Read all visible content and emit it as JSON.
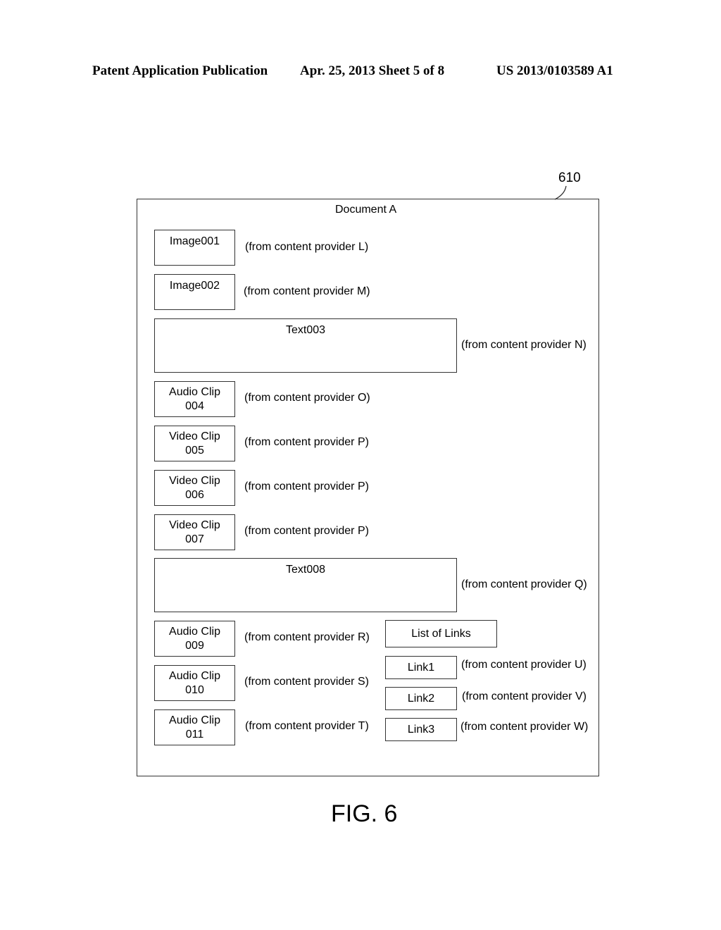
{
  "header": {
    "left": "Patent Application Publication",
    "middle": "Apr. 25, 2013  Sheet 5 of 8",
    "right": "US 2013/0103589 A1"
  },
  "reference_numeral": "610",
  "document": {
    "title": "Document A",
    "items": [
      {
        "label": "Image001",
        "source": "(from content provider L)"
      },
      {
        "label": "Image002",
        "source": "(from content provider M)"
      },
      {
        "label": "Text003",
        "source": "(from content provider N)"
      },
      {
        "label": "Audio Clip 004",
        "source": "(from content provider O)"
      },
      {
        "label": "Video Clip 005",
        "source": "(from content provider P)"
      },
      {
        "label": "Video Clip 006",
        "source": "(from content provider P)"
      },
      {
        "label": "Video Clip 007",
        "source": "(from content provider P)"
      },
      {
        "label": "Text008",
        "source": "(from content provider Q)"
      },
      {
        "label": "Audio Clip 009",
        "source": "(from content provider R)"
      },
      {
        "label": "Audio Clip 010",
        "source": "(from content provider S)"
      },
      {
        "label": "Audio Clip 011",
        "source": "(from content provider T)"
      }
    ],
    "links_list": {
      "title": "List of Links",
      "links": [
        {
          "label": "Link1",
          "source": "(from content provider U)"
        },
        {
          "label": "Link2",
          "source": "(from content provider V)"
        },
        {
          "label": "Link3",
          "source": "(from content provider W)"
        }
      ]
    }
  },
  "figure_label": "FIG. 6"
}
